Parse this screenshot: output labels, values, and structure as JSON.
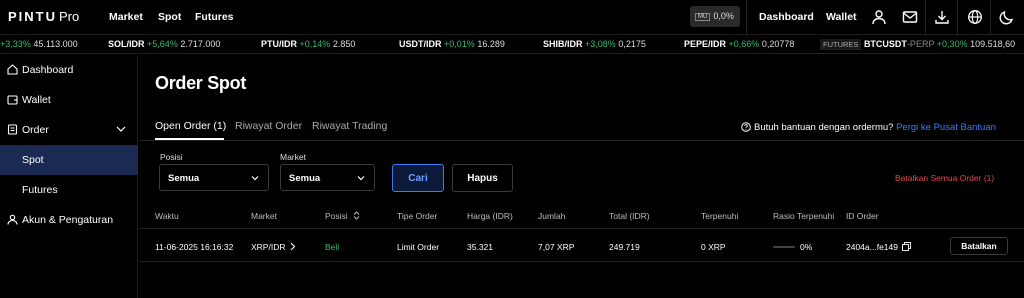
{
  "topbar": {
    "logo": "PINTU",
    "logo_suffix": "Pro",
    "nav": [
      "Market",
      "Spot",
      "Futures"
    ],
    "mu_label": "MU",
    "mu_value": "0,0%",
    "right_links": [
      "Dashboard",
      "Wallet"
    ]
  },
  "ticker": [
    {
      "pair": "",
      "change": "3,33%",
      "price": "45.113.000",
      "prefix": "+"
    },
    {
      "pair": "SOL/IDR",
      "change": "+5,64%",
      "price": "2.717.000"
    },
    {
      "pair": "PTU/IDR",
      "change": "+0,14%",
      "price": "2.850"
    },
    {
      "pair": "USDT/IDR",
      "change": "+0,01%",
      "price": "16.289"
    },
    {
      "pair": "SHIB/IDR",
      "change": "+3,08%",
      "price": "0,2175"
    },
    {
      "pair": "PEPE/IDR",
      "change": "+0,66%",
      "price": "0,20778"
    },
    {
      "badge": "FUTURES",
      "pair": "BTCUSDT",
      "suffix": "-PERP",
      "change": "+0,30%",
      "price": "109.518,60"
    }
  ],
  "sidebar": {
    "items": [
      {
        "label": "Dashboard"
      },
      {
        "label": "Wallet"
      },
      {
        "label": "Order"
      },
      {
        "label": "Spot"
      },
      {
        "label": "Futures"
      },
      {
        "label": "Akun & Pengaturan"
      }
    ]
  },
  "main": {
    "title": "Order Spot",
    "tabs": [
      "Open Order (1)",
      "Riwayat Order",
      "Riwayat Trading"
    ],
    "help_text": "Butuh bantuan dengan ordermu?",
    "help_link": "Pergi ke Pusat Bantuan",
    "filters": {
      "posisi_label": "Posisi",
      "posisi_value": "Semua",
      "market_label": "Market",
      "market_value": "Semua",
      "search_button": "Cari",
      "clear_button": "Hapus"
    },
    "cancel_all": "Batalkan Semua Order (1)",
    "table": {
      "headers": [
        "Waktu",
        "Market",
        "Posisi",
        "Tipe Order",
        "Harga (IDR)",
        "Jumlah",
        "Total (IDR)",
        "Terpenuhi",
        "Rasio Terpenuhi",
        "ID Order"
      ],
      "rows": [
        {
          "waktu": "11-06-2025 16:16:32",
          "market": "XRP/IDR",
          "posisi": "Beli",
          "tipe": "Limit Order",
          "harga": "35.321",
          "jumlah": "7,07 XRP",
          "total": "249.719",
          "terpenuhi": "0 XRP",
          "rasio": "0%",
          "id": "2404a...fe149",
          "action": "Batalkan"
        }
      ]
    }
  },
  "colors": {
    "accent": "#3d7af5",
    "positive": "#2ebd6e",
    "negative": "#e04848",
    "active_sidebar": "#1b2a52"
  }
}
